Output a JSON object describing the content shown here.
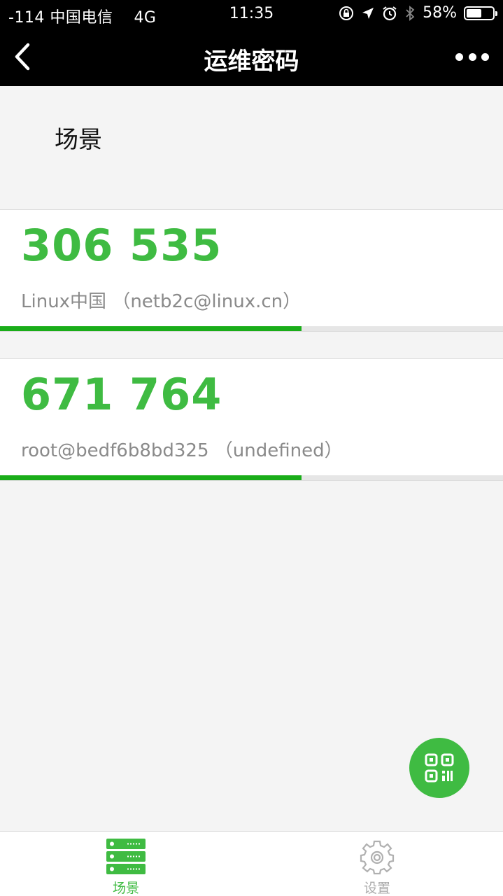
{
  "status_bar": {
    "carrier": "-114 中国电信",
    "network": "4G",
    "time": "11:35",
    "battery_text": "58%",
    "battery_level": 0.58
  },
  "nav": {
    "title": "运维密码"
  },
  "section": {
    "title": "场景"
  },
  "accounts": [
    {
      "code": "306 535",
      "label": "Linux中国 （netb2c@linux.cn）",
      "progress": 0.6
    },
    {
      "code": "671 764",
      "label": "root@bedf6b8bd325 （undefined）",
      "progress": 0.6
    }
  ],
  "tabs": [
    {
      "label": "场景",
      "icon": "server-list-icon",
      "active": true
    },
    {
      "label": "设置",
      "icon": "gear-icon",
      "active": false
    }
  ],
  "colors": {
    "accent": "#3fbb42",
    "progress": "#1aad19",
    "header_bg": "#000000"
  }
}
